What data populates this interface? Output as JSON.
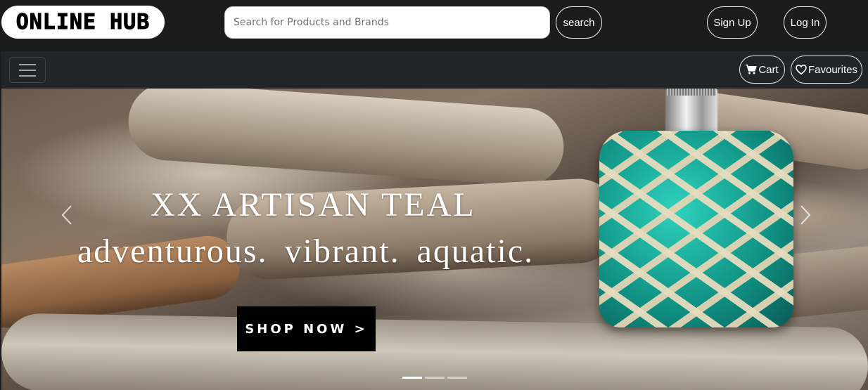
{
  "header": {
    "logo_text": "ONLINE HUB",
    "search": {
      "placeholder": "Search for Products and Brands",
      "value": ""
    },
    "search_button": "search",
    "signup_button": "Sign Up",
    "login_button": "Log In"
  },
  "navbar": {
    "menu_icon": "hamburger-icon",
    "cart": {
      "icon": "cart-icon",
      "label": "Cart"
    },
    "favourites": {
      "icon": "heart-icon",
      "label": "Favourites"
    }
  },
  "hero": {
    "title": "XX ARTISAN TEAL",
    "subtitle": "adventurous.  vibrant.  aquatic.",
    "cta_label": "SHOP NOW >",
    "prev_icon": "chevron-left-icon",
    "next_icon": "chevron-right-icon",
    "slide_count": 3,
    "active_slide": 1
  },
  "colors": {
    "header_bg": "#1c1c1c",
    "navbar_bg": "#212529",
    "cta_bg": "#000000",
    "bottle_teal": "#1fb3a3"
  }
}
